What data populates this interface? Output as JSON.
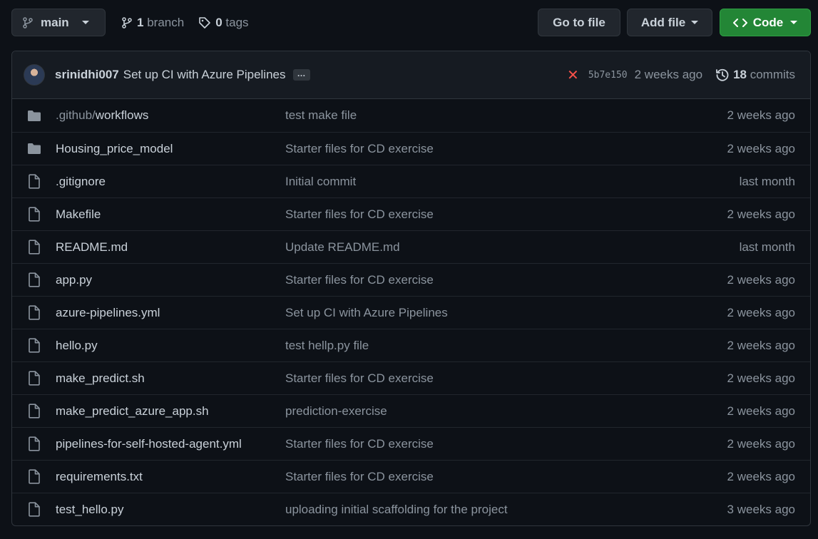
{
  "toolbar": {
    "branch_label": "main",
    "branch_count": "1",
    "branch_word": "branch",
    "tag_count": "0",
    "tag_word": "tags",
    "goto_file": "Go to file",
    "add_file": "Add file",
    "code": "Code"
  },
  "commit": {
    "author": "srinidhi007",
    "message": "Set up CI with Azure Pipelines",
    "ellipsis": "…",
    "status": "failed",
    "sha": "5b7e150",
    "time": "2 weeks ago",
    "commit_count": "18",
    "commit_word": "commits"
  },
  "colors": {
    "accent_green": "#238636",
    "status_red": "#f85149",
    "folder_icon": "#8b949e"
  },
  "files": [
    {
      "type": "dir",
      "icon": "folder-icon",
      "name_prefix": ".github/",
      "name": "workflows",
      "message": "test make file",
      "age": "2 weeks ago"
    },
    {
      "type": "dir",
      "icon": "folder-icon",
      "name_prefix": "",
      "name": "Housing_price_model",
      "message": "Starter files for CD exercise",
      "age": "2 weeks ago"
    },
    {
      "type": "file",
      "icon": "file-icon",
      "name_prefix": "",
      "name": ".gitignore",
      "message": "Initial commit",
      "age": "last month"
    },
    {
      "type": "file",
      "icon": "file-icon",
      "name_prefix": "",
      "name": "Makefile",
      "message": "Starter files for CD exercise",
      "age": "2 weeks ago"
    },
    {
      "type": "file",
      "icon": "file-icon",
      "name_prefix": "",
      "name": "README.md",
      "message": "Update README.md",
      "age": "last month"
    },
    {
      "type": "file",
      "icon": "file-icon",
      "name_prefix": "",
      "name": "app.py",
      "message": "Starter files for CD exercise",
      "age": "2 weeks ago"
    },
    {
      "type": "file",
      "icon": "file-icon",
      "name_prefix": "",
      "name": "azure-pipelines.yml",
      "message": "Set up CI with Azure Pipelines",
      "age": "2 weeks ago"
    },
    {
      "type": "file",
      "icon": "file-icon",
      "name_prefix": "",
      "name": "hello.py",
      "message": "test hellp.py file",
      "age": "2 weeks ago"
    },
    {
      "type": "file",
      "icon": "file-icon",
      "name_prefix": "",
      "name": "make_predict.sh",
      "message": "Starter files for CD exercise",
      "age": "2 weeks ago"
    },
    {
      "type": "file",
      "icon": "file-icon",
      "name_prefix": "",
      "name": "make_predict_azure_app.sh",
      "message": "prediction-exercise",
      "age": "2 weeks ago"
    },
    {
      "type": "file",
      "icon": "file-icon",
      "name_prefix": "",
      "name": "pipelines-for-self-hosted-agent.yml",
      "message": "Starter files for CD exercise",
      "age": "2 weeks ago"
    },
    {
      "type": "file",
      "icon": "file-icon",
      "name_prefix": "",
      "name": "requirements.txt",
      "message": "Starter files for CD exercise",
      "age": "2 weeks ago"
    },
    {
      "type": "file",
      "icon": "file-icon",
      "name_prefix": "",
      "name": "test_hello.py",
      "message": "uploading initial scaffolding for the project",
      "age": "3 weeks ago"
    }
  ]
}
